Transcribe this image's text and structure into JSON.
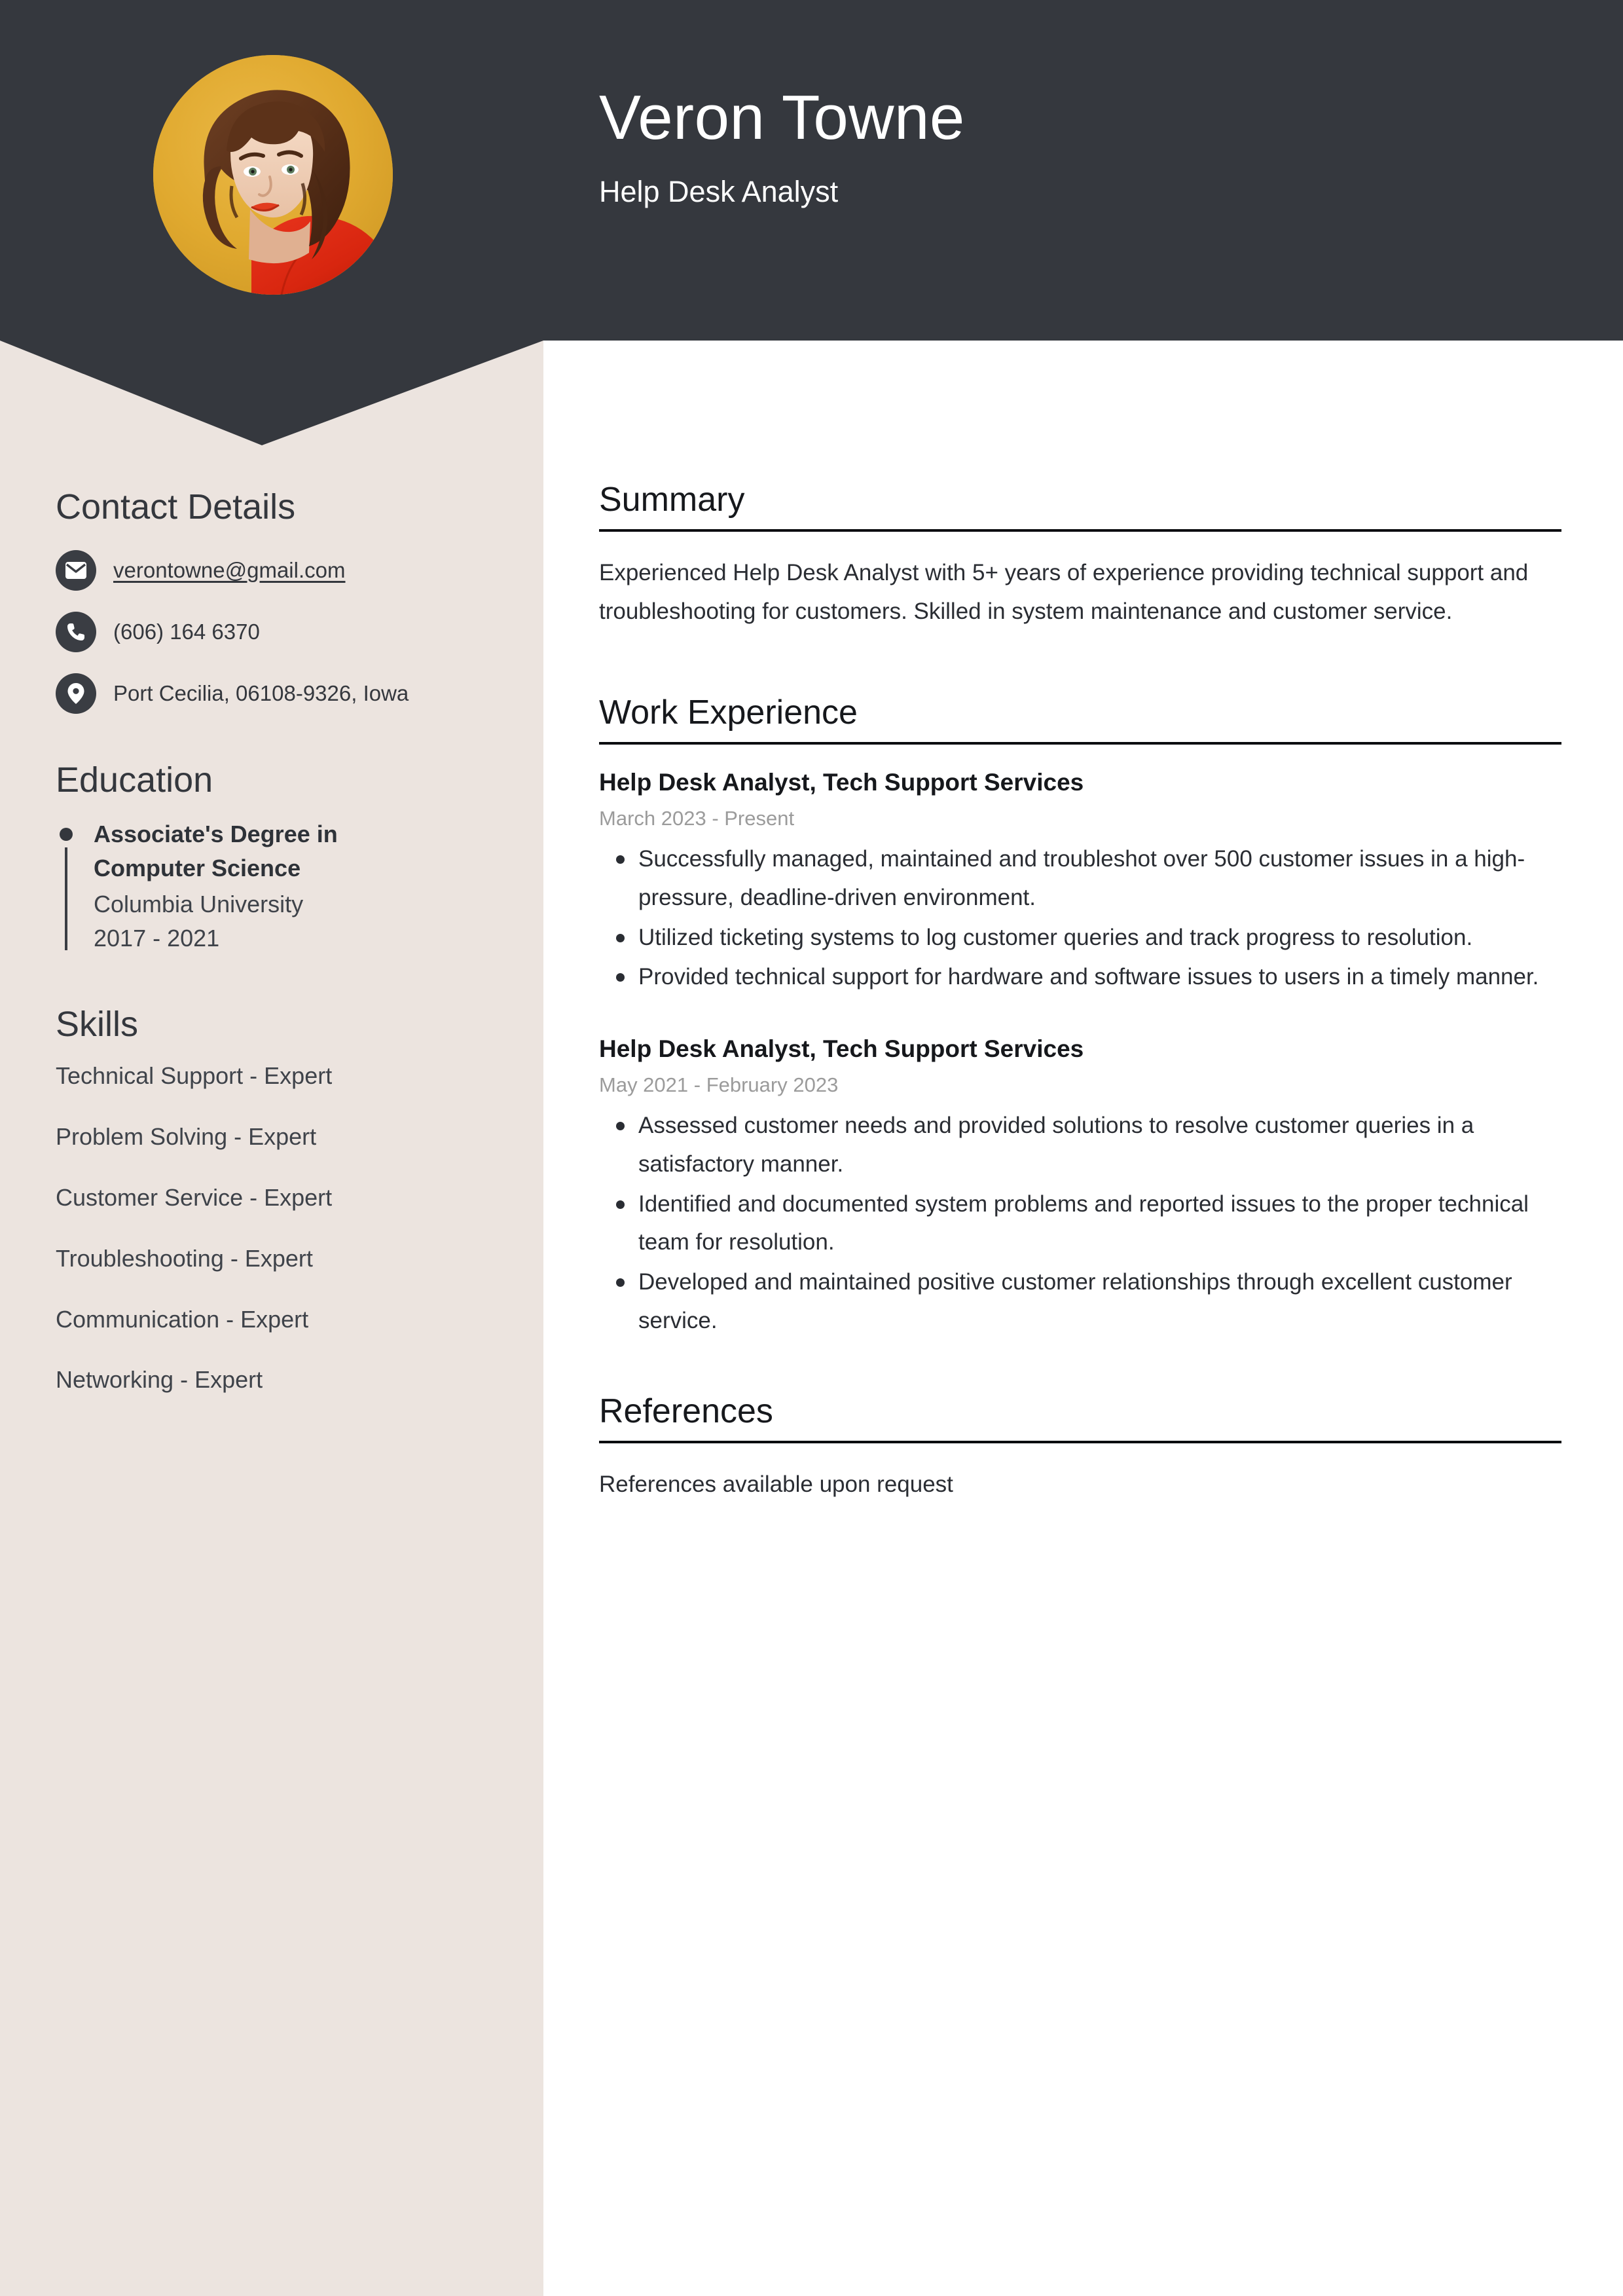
{
  "theme": {
    "header_bg": "#35383e",
    "sidebar_bg": "#ece4df",
    "page_bg": "#ffffff",
    "text_color": "#34373d",
    "muted_text": "#9b9b9b",
    "avatar_bg": "#e2ab36"
  },
  "header": {
    "name": "Veron Towne",
    "job_title": "Help Desk Analyst",
    "avatar_alt": "portrait-photo"
  },
  "sidebar": {
    "contact": {
      "heading": "Contact Details",
      "items": [
        {
          "icon": "envelope-icon",
          "value": "verontowne@gmail.com",
          "is_link": true
        },
        {
          "icon": "phone-icon",
          "value": "(606) 164 6370",
          "is_link": false
        },
        {
          "icon": "location-pin-icon",
          "value": "Port Cecilia, 06108-9326, Iowa",
          "is_link": false
        }
      ]
    },
    "education": {
      "heading": "Education",
      "items": [
        {
          "degree": "Associate's Degree in Computer Science",
          "school": "Columbia University",
          "dates": "2017 - 2021"
        }
      ]
    },
    "skills": {
      "heading": "Skills",
      "items": [
        "Technical Support - Expert",
        "Problem Solving - Expert",
        "Customer Service - Expert",
        "Troubleshooting - Expert",
        "Communication - Expert",
        "Networking - Expert"
      ]
    }
  },
  "main": {
    "summary": {
      "heading": "Summary",
      "text": "Experienced Help Desk Analyst with 5+ years of experience providing technical support and troubleshooting for customers. Skilled in system maintenance and customer service."
    },
    "work_experience": {
      "heading": "Work Experience",
      "jobs": [
        {
          "title": "Help Desk Analyst, Tech Support Services",
          "dates": "March 2023 - Present",
          "bullets": [
            "Successfully managed, maintained and troubleshot over 500 customer issues in a high-pressure, deadline-driven environment.",
            "Utilized ticketing systems to log customer queries and track progress to resolution.",
            "Provided technical support for hardware and software issues to users in a timely manner."
          ]
        },
        {
          "title": "Help Desk Analyst, Tech Support Services",
          "dates": "May 2021 - February 2023",
          "bullets": [
            "Assessed customer needs and provided solutions to resolve customer queries in a satisfactory manner.",
            "Identified and documented system problems and reported issues to the proper technical team for resolution.",
            "Developed and maintained positive customer relationships through excellent customer service."
          ]
        }
      ]
    },
    "references": {
      "heading": "References",
      "text": "References available upon request"
    }
  }
}
